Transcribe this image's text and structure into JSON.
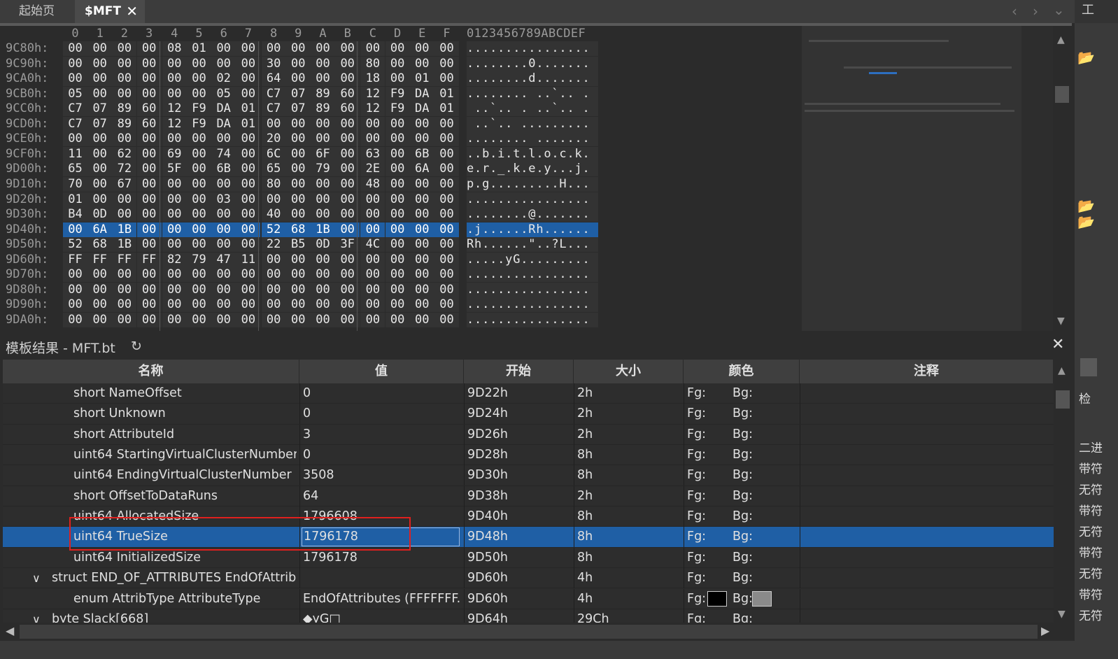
{
  "tabs": [
    {
      "label": "起始页"
    },
    {
      "label": "$MFT"
    }
  ],
  "right_panel": {
    "top_label": "工",
    "label_check": "检",
    "items": [
      "二进",
      "带符",
      "无符",
      "带符",
      "无符",
      "带符",
      "无符",
      "带符",
      "无符"
    ]
  },
  "hex": {
    "columns": [
      "0",
      "1",
      "2",
      "3",
      "4",
      "5",
      "6",
      "7",
      "8",
      "9",
      "A",
      "B",
      "C",
      "D",
      "E",
      "F"
    ],
    "ascii_header": "0123456789ABCDEF",
    "rows": [
      {
        "addr": "9C80h:",
        "bytes": [
          "00",
          "00",
          "00",
          "00",
          "08",
          "01",
          "00",
          "00",
          "00",
          "00",
          "00",
          "00",
          "00",
          "00",
          "00",
          "00"
        ],
        "ascii": "................"
      },
      {
        "addr": "9C90h:",
        "bytes": [
          "00",
          "00",
          "00",
          "00",
          "00",
          "00",
          "00",
          "00",
          "30",
          "00",
          "00",
          "00",
          "80",
          "00",
          "00",
          "00"
        ],
        "ascii": "........0......."
      },
      {
        "addr": "9CA0h:",
        "bytes": [
          "00",
          "00",
          "00",
          "00",
          "00",
          "00",
          "02",
          "00",
          "64",
          "00",
          "00",
          "00",
          "18",
          "00",
          "01",
          "00"
        ],
        "ascii": "........d......."
      },
      {
        "addr": "9CB0h:",
        "bytes": [
          "05",
          "00",
          "00",
          "00",
          "00",
          "00",
          "05",
          "00",
          "C7",
          "07",
          "89",
          "60",
          "12",
          "F9",
          "DA",
          "01"
        ],
        "ascii": "........ ..`.. ."
      },
      {
        "addr": "9CC0h:",
        "bytes": [
          "C7",
          "07",
          "89",
          "60",
          "12",
          "F9",
          "DA",
          "01",
          "C7",
          "07",
          "89",
          "60",
          "12",
          "F9",
          "DA",
          "01"
        ],
        "ascii": " ..`.. . ..`.. ."
      },
      {
        "addr": "9CD0h:",
        "bytes": [
          "C7",
          "07",
          "89",
          "60",
          "12",
          "F9",
          "DA",
          "01",
          "00",
          "00",
          "00",
          "00",
          "00",
          "00",
          "00",
          "00"
        ],
        "ascii": " ..`.. ........."
      },
      {
        "addr": "9CE0h:",
        "bytes": [
          "00",
          "00",
          "00",
          "00",
          "00",
          "00",
          "00",
          "00",
          "20",
          "00",
          "00",
          "00",
          "00",
          "00",
          "00",
          "00"
        ],
        "ascii": "........ ......."
      },
      {
        "addr": "9CF0h:",
        "bytes": [
          "11",
          "00",
          "62",
          "00",
          "69",
          "00",
          "74",
          "00",
          "6C",
          "00",
          "6F",
          "00",
          "63",
          "00",
          "6B",
          "00"
        ],
        "ascii": "..b.i.t.l.o.c.k."
      },
      {
        "addr": "9D00h:",
        "bytes": [
          "65",
          "00",
          "72",
          "00",
          "5F",
          "00",
          "6B",
          "00",
          "65",
          "00",
          "79",
          "00",
          "2E",
          "00",
          "6A",
          "00"
        ],
        "ascii": "e.r._.k.e.y...j."
      },
      {
        "addr": "9D10h:",
        "bytes": [
          "70",
          "00",
          "67",
          "00",
          "00",
          "00",
          "00",
          "00",
          "80",
          "00",
          "00",
          "00",
          "48",
          "00",
          "00",
          "00"
        ],
        "ascii": "p.g.........H..."
      },
      {
        "addr": "9D20h:",
        "bytes": [
          "01",
          "00",
          "00",
          "00",
          "00",
          "00",
          "03",
          "00",
          "00",
          "00",
          "00",
          "00",
          "00",
          "00",
          "00",
          "00"
        ],
        "ascii": "................"
      },
      {
        "addr": "9D30h:",
        "bytes": [
          "B4",
          "0D",
          "00",
          "00",
          "00",
          "00",
          "00",
          "00",
          "40",
          "00",
          "00",
          "00",
          "00",
          "00",
          "00",
          "00"
        ],
        "ascii": "........@......."
      },
      {
        "addr": "9D40h:",
        "bytes": [
          "00",
          "6A",
          "1B",
          "00",
          "00",
          "00",
          "00",
          "00",
          "52",
          "68",
          "1B",
          "00",
          "00",
          "00",
          "00",
          "00"
        ],
        "ascii": ".j......Rh......",
        "selected": true
      },
      {
        "addr": "9D50h:",
        "bytes": [
          "52",
          "68",
          "1B",
          "00",
          "00",
          "00",
          "00",
          "00",
          "22",
          "B5",
          "0D",
          "3F",
          "4C",
          "00",
          "00",
          "00"
        ],
        "ascii": "Rh......\"..?L..."
      },
      {
        "addr": "9D60h:",
        "bytes": [
          "FF",
          "FF",
          "FF",
          "FF",
          "82",
          "79",
          "47",
          "11",
          "00",
          "00",
          "00",
          "00",
          "00",
          "00",
          "00",
          "00"
        ],
        "ascii": ".....yG........."
      },
      {
        "addr": "9D70h:",
        "bytes": [
          "00",
          "00",
          "00",
          "00",
          "00",
          "00",
          "00",
          "00",
          "00",
          "00",
          "00",
          "00",
          "00",
          "00",
          "00",
          "00"
        ],
        "ascii": "................"
      },
      {
        "addr": "9D80h:",
        "bytes": [
          "00",
          "00",
          "00",
          "00",
          "00",
          "00",
          "00",
          "00",
          "00",
          "00",
          "00",
          "00",
          "00",
          "00",
          "00",
          "00"
        ],
        "ascii": "................"
      },
      {
        "addr": "9D90h:",
        "bytes": [
          "00",
          "00",
          "00",
          "00",
          "00",
          "00",
          "00",
          "00",
          "00",
          "00",
          "00",
          "00",
          "00",
          "00",
          "00",
          "00"
        ],
        "ascii": "................"
      },
      {
        "addr": "9DA0h:",
        "bytes": [
          "00",
          "00",
          "00",
          "00",
          "00",
          "00",
          "00",
          "00",
          "00",
          "00",
          "00",
          "00",
          "00",
          "00",
          "00",
          "00"
        ],
        "ascii": "................"
      }
    ]
  },
  "template": {
    "title": "模板结果 - MFT.bt",
    "headers": [
      "名称",
      "值",
      "开始",
      "大小",
      "颜色",
      "注释"
    ],
    "rows": [
      {
        "name": "short NameOffset",
        "value": "0",
        "start": "9D22h",
        "size": "2h",
        "fg": "Fg:",
        "bg": "Bg:",
        "indent": 2
      },
      {
        "name": "short Unknown",
        "value": "0",
        "start": "9D24h",
        "size": "2h",
        "fg": "Fg:",
        "bg": "Bg:",
        "indent": 2
      },
      {
        "name": "short AttributeId",
        "value": "3",
        "start": "9D26h",
        "size": "2h",
        "fg": "Fg:",
        "bg": "Bg:",
        "indent": 2
      },
      {
        "name": "uint64 StartingVirtualClusterNumber",
        "value": "0",
        "start": "9D28h",
        "size": "8h",
        "fg": "Fg:",
        "bg": "Bg:",
        "indent": 2
      },
      {
        "name": "uint64 EndingVirtualClusterNumber",
        "value": "3508",
        "start": "9D30h",
        "size": "8h",
        "fg": "Fg:",
        "bg": "Bg:",
        "indent": 2
      },
      {
        "name": "short OffsetToDataRuns",
        "value": "64",
        "start": "9D38h",
        "size": "2h",
        "fg": "Fg:",
        "bg": "Bg:",
        "indent": 2
      },
      {
        "name": "uint64 AllocatedSize",
        "value": "1796608",
        "start": "9D40h",
        "size": "8h",
        "fg": "Fg:",
        "bg": "Bg:",
        "indent": 2
      },
      {
        "name": "uint64 TrueSize",
        "value": "1796178",
        "start": "9D48h",
        "size": "8h",
        "fg": "Fg:",
        "bg": "Bg:",
        "indent": 2,
        "selected": true
      },
      {
        "name": "uint64 InitializedSize",
        "value": "1796178",
        "start": "9D50h",
        "size": "8h",
        "fg": "Fg:",
        "bg": "Bg:",
        "indent": 2
      },
      {
        "name": "struct END_OF_ATTRIBUTES EndOfAttrib...",
        "value": "",
        "start": "9D60h",
        "size": "4h",
        "fg": "Fg:",
        "bg": "Bg:",
        "indent": 1,
        "expander": true
      },
      {
        "name": "enum AttribType AttributeType",
        "value": "EndOfAttributes (FFFFFFF...",
        "start": "9D60h",
        "size": "4h",
        "fg": "Fg:",
        "bg": "Bg:",
        "indent": 2,
        "swatches": true,
        "fg_color": "#000000",
        "bg_color": "#8a8a8a"
      },
      {
        "name": "byte Slack[668]",
        "value": "◆yG□",
        "start": "9D64h",
        "size": "29Ch",
        "fg": "Fg:",
        "bg": "Bg:",
        "indent": 1,
        "expander": true
      }
    ]
  },
  "colors": {
    "selection": "#1f5fa5",
    "highlight_box": "#e0201e"
  }
}
